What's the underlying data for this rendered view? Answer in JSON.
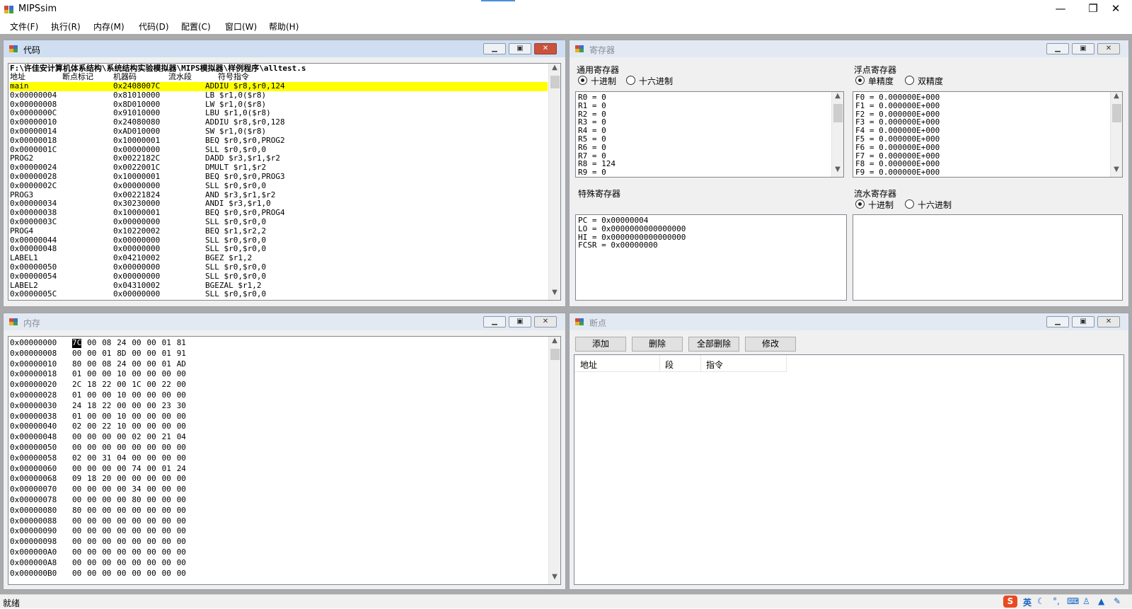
{
  "window": {
    "title": "MIPSsim",
    "minimize": "—",
    "maximize": "❐",
    "close": "✕"
  },
  "menu": [
    "文件(F)",
    "执行(R)",
    "内存(M)",
    "代码(D)",
    "配置(C)",
    "窗口(W)",
    "帮助(H)"
  ],
  "code": {
    "title": "代码",
    "path": "F:\\许佳安计算机体系结构\\系统结构实验模拟器\\MIPS模拟器\\样例程序\\alltest.s",
    "headers": [
      "地址",
      "断点标记",
      "机器码",
      "流水段",
      "符号指令"
    ],
    "rows": [
      {
        "addr": "main",
        "code": "0x2408007C",
        "asm": "ADDIU $r8,$r0,124",
        "highlight": true
      },
      {
        "addr": "0x00000004",
        "code": "0x81010000",
        "asm": "LB $r1,0($r8)"
      },
      {
        "addr": "0x00000008",
        "code": "0x8D010000",
        "asm": "LW $r1,0($r8)"
      },
      {
        "addr": "0x0000000C",
        "code": "0x91010000",
        "asm": "LBU $r1,0($r8)"
      },
      {
        "addr": "0x00000010",
        "code": "0x24080080",
        "asm": "ADDIU $r8,$r0,128"
      },
      {
        "addr": "0x00000014",
        "code": "0xAD010000",
        "asm": "SW $r1,0($r8)"
      },
      {
        "addr": "0x00000018",
        "code": "0x10000001",
        "asm": "BEQ $r0,$r0,PROG2"
      },
      {
        "addr": "0x0000001C",
        "code": "0x00000000",
        "asm": "SLL $r0,$r0,0"
      },
      {
        "addr": "PROG2",
        "code": "0x0022182C",
        "asm": "DADD $r3,$r1,$r2"
      },
      {
        "addr": "0x00000024",
        "code": "0x0022001C",
        "asm": "DMULT $r1,$r2"
      },
      {
        "addr": "0x00000028",
        "code": "0x10000001",
        "asm": "BEQ $r0,$r0,PROG3"
      },
      {
        "addr": "0x0000002C",
        "code": "0x00000000",
        "asm": "SLL $r0,$r0,0"
      },
      {
        "addr": "PROG3",
        "code": "0x00221824",
        "asm": "AND $r3,$r1,$r2"
      },
      {
        "addr": "0x00000034",
        "code": "0x30230000",
        "asm": "ANDI $r3,$r1,0"
      },
      {
        "addr": "0x00000038",
        "code": "0x10000001",
        "asm": "BEQ $r0,$r0,PROG4"
      },
      {
        "addr": "0x0000003C",
        "code": "0x00000000",
        "asm": "SLL $r0,$r0,0"
      },
      {
        "addr": "PROG4",
        "code": "0x10220002",
        "asm": "BEQ $r1,$r2,2"
      },
      {
        "addr": "0x00000044",
        "code": "0x00000000",
        "asm": "SLL $r0,$r0,0"
      },
      {
        "addr": "0x00000048",
        "code": "0x00000000",
        "asm": "SLL $r0,$r0,0"
      },
      {
        "addr": "LABEL1",
        "code": "0x04210002",
        "asm": "BGEZ $r1,2"
      },
      {
        "addr": "0x00000050",
        "code": "0x00000000",
        "asm": "SLL $r0,$r0,0"
      },
      {
        "addr": "0x00000054",
        "code": "0x00000000",
        "asm": "SLL $r0,$r0,0"
      },
      {
        "addr": "LABEL2",
        "code": "0x04310002",
        "asm": "BGEZAL $r1,2"
      },
      {
        "addr": "0x0000005C",
        "code": "0x00000000",
        "asm": "SLL $r0,$r0,0"
      }
    ]
  },
  "registers": {
    "title": "寄存器",
    "general": {
      "label": "通用寄存器",
      "opt1": "十进制",
      "opt2": "十六进制",
      "lines": [
        "R0 = 0",
        "R1 = 0",
        "R2 = 0",
        "R3 = 0",
        "R4 = 0",
        "R5 = 0",
        "R6 = 0",
        "R7 = 0",
        "R8 = 124",
        "R9 = 0"
      ]
    },
    "float": {
      "label": "浮点寄存器",
      "opt1": "单精度",
      "opt2": "双精度",
      "lines": [
        "F0 = 0.000000E+000",
        "F1 = 0.000000E+000",
        "F2 = 0.000000E+000",
        "F3 = 0.000000E+000",
        "F4 = 0.000000E+000",
        "F5 = 0.000000E+000",
        "F6 = 0.000000E+000",
        "F7 = 0.000000E+000",
        "F8 = 0.000000E+000",
        "F9 = 0.000000E+000"
      ]
    },
    "special": {
      "label": "特殊寄存器",
      "lines": [
        "PC = 0x00000004",
        "LO = 0x0000000000000000",
        "HI = 0x0000000000000000",
        "FCSR = 0x00000000"
      ]
    },
    "pipeline": {
      "label": "流水寄存器",
      "opt1": "十进制",
      "opt2": "十六进制"
    }
  },
  "memory": {
    "title": "内存",
    "rows": [
      {
        "addr": "0x00000000",
        "bytes": [
          "7C",
          "00",
          "08",
          "24",
          "00",
          "00",
          "01",
          "81"
        ]
      },
      {
        "addr": "0x00000008",
        "bytes": [
          "00",
          "00",
          "01",
          "8D",
          "00",
          "00",
          "01",
          "91"
        ]
      },
      {
        "addr": "0x00000010",
        "bytes": [
          "80",
          "00",
          "08",
          "24",
          "00",
          "00",
          "01",
          "AD"
        ]
      },
      {
        "addr": "0x00000018",
        "bytes": [
          "01",
          "00",
          "00",
          "10",
          "00",
          "00",
          "00",
          "00"
        ]
      },
      {
        "addr": "0x00000020",
        "bytes": [
          "2C",
          "18",
          "22",
          "00",
          "1C",
          "00",
          "22",
          "00"
        ]
      },
      {
        "addr": "0x00000028",
        "bytes": [
          "01",
          "00",
          "00",
          "10",
          "00",
          "00",
          "00",
          "00"
        ]
      },
      {
        "addr": "0x00000030",
        "bytes": [
          "24",
          "18",
          "22",
          "00",
          "00",
          "00",
          "23",
          "30"
        ]
      },
      {
        "addr": "0x00000038",
        "bytes": [
          "01",
          "00",
          "00",
          "10",
          "00",
          "00",
          "00",
          "00"
        ]
      },
      {
        "addr": "0x00000040",
        "bytes": [
          "02",
          "00",
          "22",
          "10",
          "00",
          "00",
          "00",
          "00"
        ]
      },
      {
        "addr": "0x00000048",
        "bytes": [
          "00",
          "00",
          "00",
          "00",
          "02",
          "00",
          "21",
          "04"
        ]
      },
      {
        "addr": "0x00000050",
        "bytes": [
          "00",
          "00",
          "00",
          "00",
          "00",
          "00",
          "00",
          "00"
        ]
      },
      {
        "addr": "0x00000058",
        "bytes": [
          "02",
          "00",
          "31",
          "04",
          "00",
          "00",
          "00",
          "00"
        ]
      },
      {
        "addr": "0x00000060",
        "bytes": [
          "00",
          "00",
          "00",
          "00",
          "74",
          "00",
          "01",
          "24"
        ]
      },
      {
        "addr": "0x00000068",
        "bytes": [
          "09",
          "18",
          "20",
          "00",
          "00",
          "00",
          "00",
          "00"
        ]
      },
      {
        "addr": "0x00000070",
        "bytes": [
          "00",
          "00",
          "00",
          "00",
          "34",
          "00",
          "00",
          "00"
        ]
      },
      {
        "addr": "0x00000078",
        "bytes": [
          "00",
          "00",
          "00",
          "00",
          "80",
          "00",
          "00",
          "00"
        ]
      },
      {
        "addr": "0x00000080",
        "bytes": [
          "80",
          "00",
          "00",
          "00",
          "00",
          "00",
          "00",
          "00"
        ]
      },
      {
        "addr": "0x00000088",
        "bytes": [
          "00",
          "00",
          "00",
          "00",
          "00",
          "00",
          "00",
          "00"
        ]
      },
      {
        "addr": "0x00000090",
        "bytes": [
          "00",
          "00",
          "00",
          "00",
          "00",
          "00",
          "00",
          "00"
        ]
      },
      {
        "addr": "0x00000098",
        "bytes": [
          "00",
          "00",
          "00",
          "00",
          "00",
          "00",
          "00",
          "00"
        ]
      },
      {
        "addr": "0x000000A0",
        "bytes": [
          "00",
          "00",
          "00",
          "00",
          "00",
          "00",
          "00",
          "00"
        ]
      },
      {
        "addr": "0x000000A8",
        "bytes": [
          "00",
          "00",
          "00",
          "00",
          "00",
          "00",
          "00",
          "00"
        ]
      },
      {
        "addr": "0x000000B0",
        "bytes": [
          "00",
          "00",
          "00",
          "00",
          "00",
          "00",
          "00",
          "00"
        ]
      }
    ]
  },
  "breakpoints": {
    "title": "断点",
    "buttons": [
      "添加",
      "删除",
      "全部删除",
      "修改"
    ],
    "columns": [
      "地址",
      "段",
      "指令"
    ]
  },
  "status": {
    "text": "就绪",
    "ime_lang": "英"
  },
  "colors": {
    "highlight": "#ffff00",
    "active_header": "#cfdff1",
    "close_red": "#c9523f"
  }
}
